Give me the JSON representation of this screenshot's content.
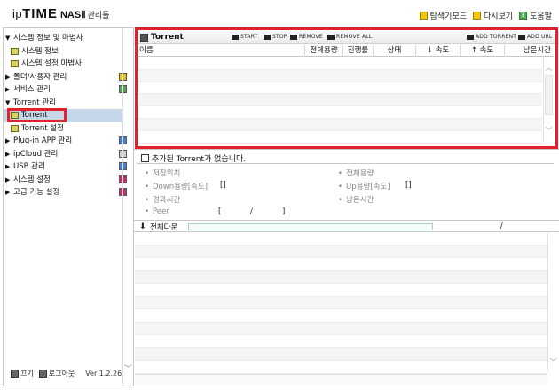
{
  "brand": {
    "ip": "ip",
    "time": "TIME",
    "nas": "NASⅡ",
    "manager": "관리툴"
  },
  "top_links": {
    "explore_mode": "탐색기모드",
    "refresh": "다시보기",
    "help": "도움말"
  },
  "sidebar": {
    "items": [
      {
        "label": "시스템 정보 및 마법사",
        "type": "cat",
        "arrow": "▼"
      },
      {
        "label": "시스템 정보",
        "type": "sub"
      },
      {
        "label": "시스템 설정 마법사",
        "type": "sub"
      },
      {
        "label": "폴더/사용자 관리",
        "type": "cat",
        "arrow": "▶",
        "icon": "yellow"
      },
      {
        "label": "서비스 관리",
        "type": "cat",
        "arrow": "▶",
        "icon": "green"
      },
      {
        "label": "Torrent 관리",
        "type": "cat",
        "arrow": "▼"
      },
      {
        "label": "Torrent",
        "type": "sub",
        "active": true
      },
      {
        "label": "Torrent 설정",
        "type": "sub"
      },
      {
        "label": "Plug-in APP 관리",
        "type": "cat",
        "arrow": "▶",
        "icon": "blue"
      },
      {
        "label": "ipCloud 관리",
        "type": "cat",
        "arrow": "▶",
        "icon": "gray"
      },
      {
        "label": "USB 관리",
        "type": "cat",
        "arrow": "▶",
        "icon": "blue"
      },
      {
        "label": "시스템 설정",
        "type": "cat",
        "arrow": "▶",
        "icon": "red"
      },
      {
        "label": "고급 기능 설정",
        "type": "cat",
        "arrow": "▶",
        "icon": "red"
      }
    ],
    "footer": {
      "power_label": "끄기",
      "logout_label": "로그아웃",
      "version": "Ver 1.2.26"
    }
  },
  "torrent": {
    "title": "Torrent",
    "buttons": {
      "start": "START",
      "stop": "STOP",
      "remove": "REMOVE",
      "remove_all": "REMOVE ALL",
      "add_torrent": "ADD TORRENT",
      "add_url": "ADD URL"
    },
    "columns": [
      "이름",
      "전체용량",
      "진행률",
      "상태",
      "↓ 속도",
      "↑ 속도",
      "남은시간"
    ]
  },
  "info": {
    "title": "추가된 Torrent가 없습니다.",
    "fields": {
      "save_location": "저장위치",
      "total_size": "전체용량",
      "down_amount": "Down용량[속도]",
      "down_value": "[]",
      "up_amount": "Up용량[속도]",
      "up_value": "[]",
      "elapsed": "경과시간",
      "remaining": "남은시간",
      "peer": "Peer",
      "peer_open": "[",
      "peer_slash": "/",
      "peer_close": "]"
    }
  },
  "all_download": {
    "label": "전체다운",
    "progress": 0,
    "slash": "/"
  },
  "colors": {
    "highlight_box": "#e3212b",
    "active_item": "#c7d7ea"
  }
}
